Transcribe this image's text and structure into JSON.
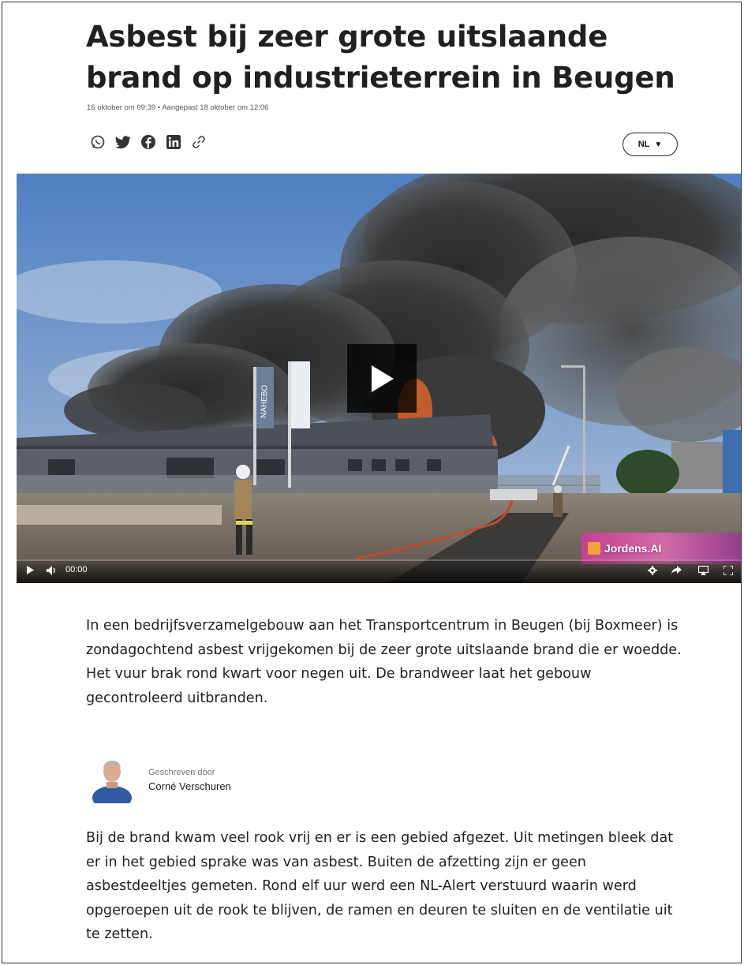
{
  "article": {
    "title": "Asbest bij zeer grote uitslaande brand op industrieterrein in Beugen",
    "meta": "16 oktober om 09:39 • Aangepast 18 oktober om 12:06",
    "language": "NL",
    "share_icons": [
      "whatsapp-icon",
      "twitter-icon",
      "facebook-icon",
      "linkedin-icon",
      "link-icon"
    ],
    "paragraph1": "In een bedrijfsverzamelgebouw aan het Transportcentrum in Beugen (bij Boxmeer) is zondagochtend asbest vrijgekomen bij de zeer grote uitslaande brand die er woedde. Het vuur brak rond kwart voor negen uit. De brandweer laat het gebouw gecontroleerd uitbranden.",
    "author_label": "Geschreven door",
    "author_name": "Corné Verschuren",
    "paragraph2": "Bij de brand kwam veel rook vrij en er is een gebied afgezet. Uit metingen bleek dat er in het gebied sprake was van asbest. Buiten de afzetting zijn er geen asbestdeeltjes gemeten. Rond elf uur werd een NL-Alert verstuurd waarin werd opgeroepen uit de rook te blijven, de ramen en deuren te sluiten en de ventilatie uit te zetten."
  },
  "video": {
    "time": "00:00",
    "watermark": "Jordens.AI",
    "flag_text": "NAHEBO"
  }
}
